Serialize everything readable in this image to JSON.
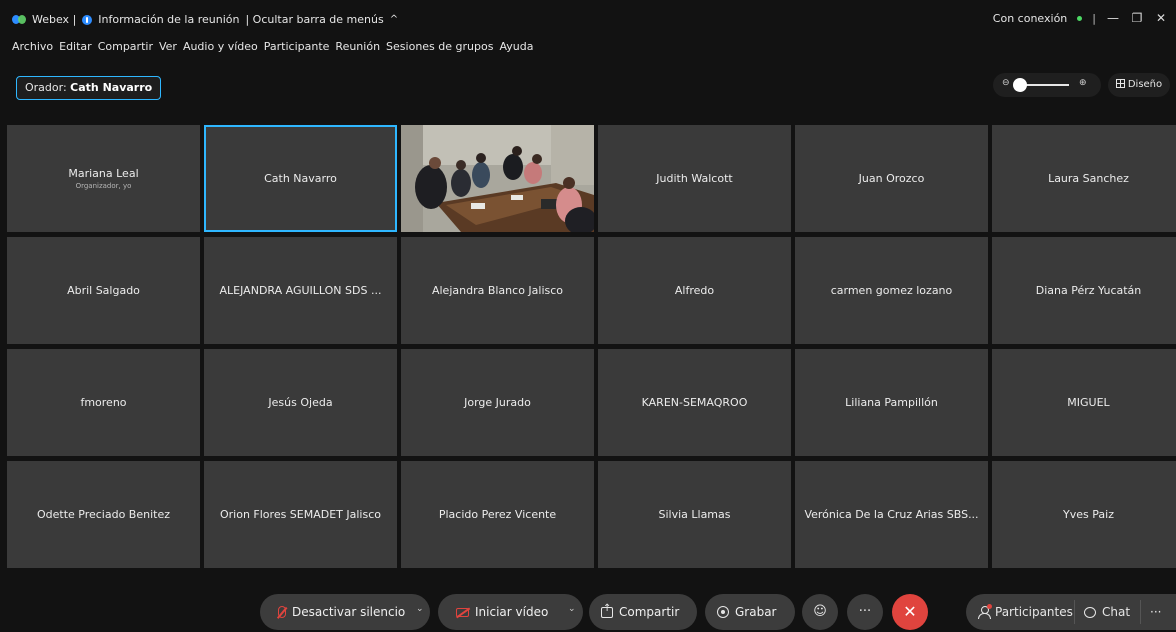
{
  "titlebar": {
    "app": "Webex |",
    "meeting_info": "Información de la reunión",
    "hide_menubar": "| Ocultar barra de menús",
    "hide_chevron": "^",
    "connection": "Con conexión",
    "separator": "|",
    "minimize": "—",
    "restore": "❐",
    "close": "✕"
  },
  "menubar": {
    "items": [
      "Archivo",
      "Editar",
      "Compartir",
      "Ver",
      "Audio y vídeo",
      "Participante",
      "Reunión",
      "Sesiones de grupos",
      "Ayuda"
    ]
  },
  "speaker": {
    "label": "Orador:",
    "name": "Cath Navarro"
  },
  "view": {
    "zoom_out": "⊖",
    "zoom_in": "⊕",
    "zoom_level": 0.05,
    "layout_label": "Diseño"
  },
  "participants": [
    {
      "name": "Mariana Leal",
      "role": "Organizador, yo"
    },
    {
      "name": "Cath Navarro",
      "active": true
    },
    {
      "name": "",
      "video": true
    },
    {
      "name": "Judith Walcott"
    },
    {
      "name": "Juan Orozco"
    },
    {
      "name": "Laura Sanchez"
    },
    {
      "name": "Abril Salgado"
    },
    {
      "name": "ALEJANDRA AGUILLON SDS ..."
    },
    {
      "name": "Alejandra Blanco Jalisco"
    },
    {
      "name": "Alfredo"
    },
    {
      "name": "carmen gomez lozano"
    },
    {
      "name": "Diana Pérz Yucatán"
    },
    {
      "name": "fmoreno"
    },
    {
      "name": "Jesús Ojeda"
    },
    {
      "name": "Jorge Jurado"
    },
    {
      "name": "KAREN-SEMAQROO"
    },
    {
      "name": "Liliana Pampillón"
    },
    {
      "name": "MIGUEL"
    },
    {
      "name": "Odette Preciado Benitez"
    },
    {
      "name": "Orion Flores SEMADET Jalisco"
    },
    {
      "name": "Placido Perez Vicente"
    },
    {
      "name": "Silvia Llamas"
    },
    {
      "name": "Verónica De la Cruz Arias SBS..."
    },
    {
      "name": "Yves Paiz"
    }
  ],
  "controls": {
    "unmute": "Desactivar silencio",
    "start_video": "Iniciar vídeo",
    "share": "Compartir",
    "record": "Grabar",
    "reactions": "☺",
    "more": "···",
    "end": "✕",
    "caret": "⌄",
    "participants": "Participantes",
    "chat": "Chat",
    "panel_more": "···"
  },
  "colors": {
    "accent": "#2fb7ff",
    "end_call": "#e0443e",
    "muted": "#e0443e",
    "online": "#4cd964",
    "tile": "#3a3a3a",
    "background": "#121212"
  }
}
